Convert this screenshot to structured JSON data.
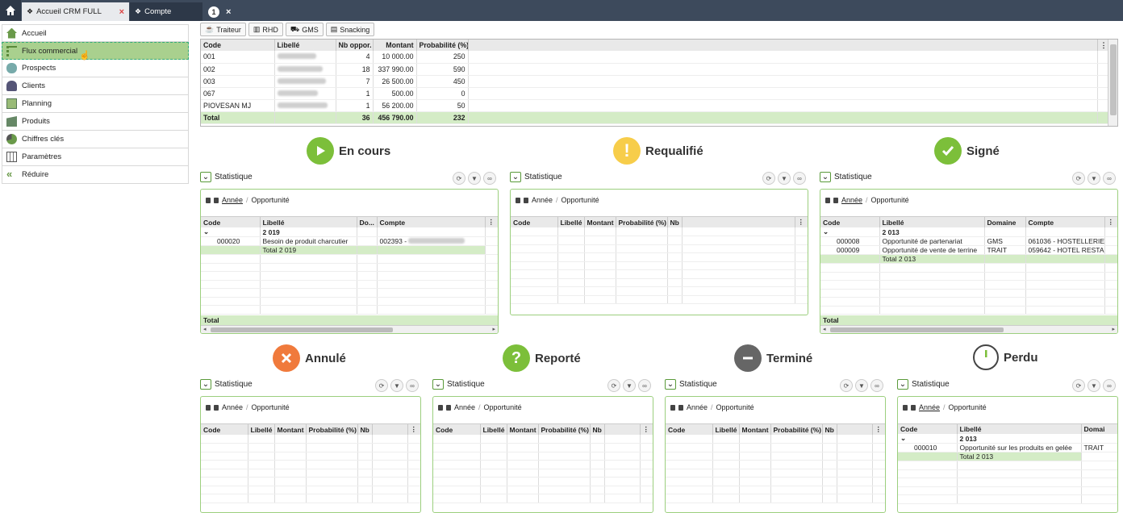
{
  "tabs": [
    {
      "label": "Accueil CRM FULL",
      "close": "×"
    },
    {
      "label": "Compte"
    },
    {
      "badge": "1",
      "close": "×"
    }
  ],
  "sidebar": {
    "items": [
      {
        "label": "Accueil",
        "icon": "home-icon"
      },
      {
        "label": "Flux commercial",
        "icon": "flow-icon"
      },
      {
        "label": "Prospects",
        "icon": "prospects-icon"
      },
      {
        "label": "Clients",
        "icon": "clients-icon"
      },
      {
        "label": "Planning",
        "icon": "planning-icon"
      },
      {
        "label": "Produits",
        "icon": "products-icon"
      },
      {
        "label": "Chiffres clés",
        "icon": "pie-icon"
      },
      {
        "label": "Paramètres",
        "icon": "settings-icon"
      },
      {
        "label": "Réduire",
        "icon": "collapse-icon"
      }
    ]
  },
  "filters": [
    {
      "label": "Traiteur"
    },
    {
      "label": "RHD"
    },
    {
      "label": "GMS"
    },
    {
      "label": "Snacking"
    }
  ],
  "main_table": {
    "headers": [
      "Code",
      "Libellé",
      "Nb oppor.",
      "Montant",
      "Probabilité (%)"
    ],
    "rows": [
      {
        "code": "001",
        "nb": "4",
        "montant": "10 000.00",
        "prob": "250"
      },
      {
        "code": "002",
        "nb": "18",
        "montant": "337 990.00",
        "prob": "590"
      },
      {
        "code": "003",
        "nb": "7",
        "montant": "26 500.00",
        "prob": "450"
      },
      {
        "code": "067",
        "nb": "1",
        "montant": "500.00",
        "prob": "0"
      },
      {
        "code": "PIOVESAN MJ",
        "nb": "1",
        "montant": "56 200.00",
        "prob": "50"
      }
    ],
    "total": {
      "label": "Total",
      "nb": "36",
      "montant": "456 790.00",
      "prob": "232"
    }
  },
  "stat_label": "Statistique",
  "nav": {
    "annee": "Année",
    "sep": "/",
    "opportunite": "Opportunité"
  },
  "total_label": "Total",
  "statuses": {
    "en_cours": "En cours",
    "requalifie": "Requalifié",
    "signe": "Signé",
    "annule": "Annulé",
    "reporte": "Reporté",
    "termine": "Terminé",
    "perdu": "Perdu"
  },
  "colors": {
    "green": "#8bc34a",
    "yellow": "#f5c518",
    "orange": "#f07a3c",
    "grey": "#666666",
    "accent": "#a9d08e"
  },
  "en_cours_grid": {
    "headers": [
      "Code",
      "Libellé",
      "Do...",
      "Compte"
    ],
    "group": "2 019",
    "row": {
      "code": "000020",
      "libelle": "Besoin de produit charcutier",
      "compte": "002393 -"
    },
    "subtotal": "Total 2 019"
  },
  "empty_headers": [
    "Code",
    "Libellé",
    "Montant",
    "Probabilité (%)",
    "Nb"
  ],
  "signe_grid": {
    "headers": [
      "Code",
      "Libellé",
      "Domaine",
      "Compte"
    ],
    "group": "2 013",
    "rows": [
      {
        "code": "000008",
        "libelle": "Opportunité de partenariat",
        "domaine": "GMS",
        "compte": "061036 - HOSTELLERIE"
      },
      {
        "code": "000009",
        "libelle": "Opportunité de vente de terrine",
        "domaine": "TRAIT",
        "compte": "059642 - HOTEL RESTA"
      }
    ],
    "subtotal": "Total 2 013"
  },
  "perdu_grid": {
    "headers": [
      "Code",
      "Libellé",
      "Domai"
    ],
    "group": "2 013",
    "row": {
      "code": "000010",
      "libelle": "Opportunité sur les produits en gelée",
      "domaine": "TRAIT"
    },
    "subtotal": "Total 2 013"
  }
}
